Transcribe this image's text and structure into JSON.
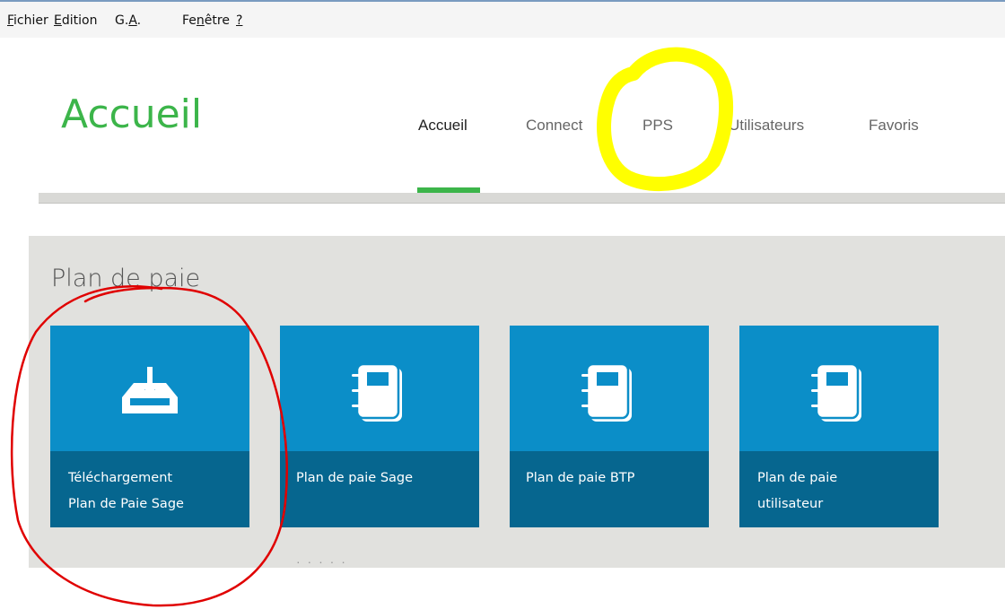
{
  "menubar": {
    "items": [
      {
        "pre": "",
        "mn": "F",
        "post": "ichier"
      },
      {
        "pre": "",
        "mn": "E",
        "post": "dition"
      },
      {
        "pre": "G.",
        "mn": "A",
        "post": "."
      },
      {
        "pre": "Fe",
        "mn": "n",
        "post": "être"
      },
      {
        "pre": "",
        "mn": "?",
        "post": ""
      }
    ]
  },
  "header": {
    "title": "Accueil",
    "tabs": [
      "Accueil",
      "Connect",
      "PPS",
      "Utilisateurs",
      "Favoris"
    ],
    "active_tab": "Accueil"
  },
  "section": {
    "title": "Plan de paie",
    "tiles": [
      {
        "label": "Téléchargement\nPlan de Paie Sage",
        "icon": "download-tray-icon"
      },
      {
        "label": "Plan de paie Sage",
        "icon": "notebook-icon"
      },
      {
        "label": "Plan de paie BTP",
        "icon": "notebook-icon"
      },
      {
        "label": "Plan de paie\nutilisateur",
        "icon": "notebook-icon"
      }
    ]
  },
  "colors": {
    "accent_green": "#3cb54a",
    "tile_top": "#0b8ec8",
    "tile_bottom": "#06668f",
    "panel_bg": "#e1e1de",
    "annotation_yellow": "#ffff00",
    "annotation_red": "#e00000"
  }
}
